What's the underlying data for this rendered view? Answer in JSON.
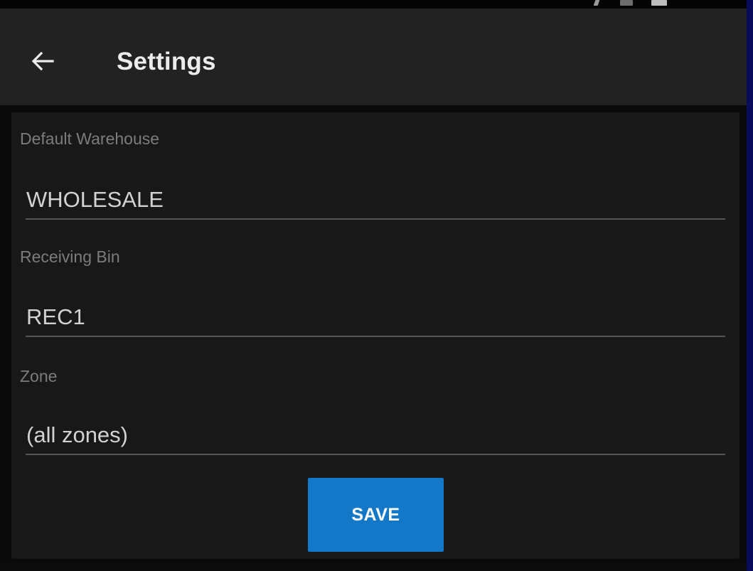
{
  "app_bar": {
    "title": "Settings",
    "back_icon": "arrow-left-icon"
  },
  "form": {
    "fields": [
      {
        "label": "Default Warehouse",
        "value": "WHOLESALE"
      },
      {
        "label": "Receiving Bin",
        "value": "REC1"
      },
      {
        "label": "Zone",
        "value": "(all zones)"
      }
    ],
    "save_label": "SAVE"
  },
  "colors": {
    "app_bar_background": "#222222",
    "card_background": "#181818",
    "accent": "#1478c8",
    "underline": "#545454",
    "label_text": "#7c7c7c",
    "value_text": "#d2d2d2",
    "side_frame": "#0b0b5c"
  }
}
